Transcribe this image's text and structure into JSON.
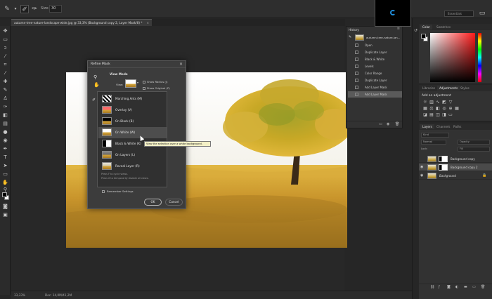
{
  "options_bar": {
    "size_label": "Size:",
    "size_value": "30",
    "workspace": "Essentials"
  },
  "document_tab": {
    "title": "autumn-tree-nature-landscape-wide.jpg @ 33,3% (Background copy 2, Layer Mask/8) *",
    "close": "×"
  },
  "status_bar": {
    "zoom": "33,33%",
    "doc_size": "Doc: 14,0M/41,2M"
  },
  "history": {
    "title": "History",
    "menu": "≡",
    "snapshot_label": "autumn-tree-nature-lan...",
    "items": [
      "Open",
      "Duplicate Layer",
      "Black & White",
      "Levels",
      "Color Range",
      "Duplicate Layer",
      "Add Layer Mask",
      "Add Layer Mask"
    ],
    "active_index": 7
  },
  "color_panel": {
    "tabs": [
      "Color",
      "Swatches"
    ]
  },
  "adjustments_panel": {
    "tabs": [
      "Libraries",
      "Adjustments",
      "Styles"
    ],
    "title": "Add an adjustment"
  },
  "layers_panel": {
    "tabs": [
      "Layers",
      "Channels",
      "Paths"
    ],
    "kind_field": "Kind",
    "blend_mode": "Normal",
    "opacity": "Opacity",
    "lock_label": "Lock:",
    "fill": "Fill",
    "layers": [
      {
        "name": "Background copy",
        "selected": false,
        "has_mask": true,
        "visible": false,
        "italic": false
      },
      {
        "name": "Background copy 2",
        "selected": true,
        "has_mask": true,
        "visible": true,
        "italic": false
      },
      {
        "name": "Background",
        "selected": false,
        "has_mask": false,
        "visible": true,
        "italic": true
      }
    ]
  },
  "refine_mask": {
    "title": "Refine Mask",
    "close": "×",
    "view_mode_heading": "View Mode",
    "view_label": "View:",
    "show_radius": "Show Radius (J)",
    "show_original": "Show Original (P)",
    "remember_settings": "Remember Settings",
    "ok_label": "OK",
    "cancel_label": "Cancel",
    "view_options": [
      {
        "label": "Marching Ants (M)",
        "thumb": "ants"
      },
      {
        "label": "Overlay (V)",
        "thumb": "overlay"
      },
      {
        "label": "On Black (B)",
        "thumb": "black"
      },
      {
        "label": "On White (W)",
        "thumb": "white"
      },
      {
        "label": "Black & White (K)",
        "thumb": "bw"
      },
      {
        "label": "On Layers (L)",
        "thumb": "layers"
      },
      {
        "label": "Reveal Layer (R)",
        "thumb": "reveal"
      }
    ],
    "hovered_index": 3,
    "hint_line1": "Press F to cycle views.",
    "hint_line2": "Press X to temporarily disable all views."
  },
  "tooltip": {
    "text": "View the selection over a white background."
  },
  "colors": {
    "accent_blue": "#1f8bd6",
    "tooltip_bg": "#f3f0c6",
    "panel_bg": "#323232"
  }
}
